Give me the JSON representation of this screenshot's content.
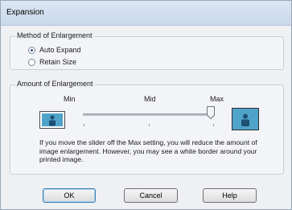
{
  "window": {
    "title": "Expansion"
  },
  "method_group": {
    "legend": "Method of Enlargement",
    "options": [
      {
        "label": "Auto Expand",
        "checked": true
      },
      {
        "label": "Retain Size",
        "checked": false
      }
    ]
  },
  "amount_group": {
    "legend": "Amount of Enlargement",
    "scale": {
      "min": "Min",
      "mid": "Mid",
      "max": "Max"
    },
    "slider_value_fraction": 1.0,
    "note": "If you move the slider off the Max setting, you will reduce the amount of image enlargement. However, you may see a white border around your printed image."
  },
  "buttons": {
    "ok": "OK",
    "cancel": "Cancel",
    "help": "Help"
  },
  "colors": {
    "accent": "#4fa3c9",
    "title_bar": "#c9d8ec"
  },
  "icons": {
    "small_preview": "bordered-image-icon",
    "large_preview": "borderless-image-icon",
    "thumb": "slider-thumb-icon"
  }
}
